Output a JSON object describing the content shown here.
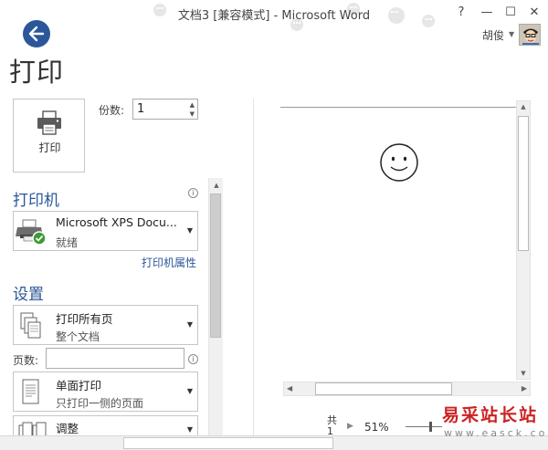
{
  "window": {
    "title": "文档3 [兼容模式] - Microsoft Word",
    "help_label": "?",
    "minimize_label": "—",
    "maximize_label": "☐",
    "close_label": "✕"
  },
  "user": {
    "name": "胡俊"
  },
  "page": {
    "title": "打印"
  },
  "print": {
    "button_label": "打印",
    "copies_label": "份数:",
    "copies_value": "1"
  },
  "printer": {
    "heading": "打印机",
    "name": "Microsoft XPS Docu...",
    "status": "就绪",
    "properties_link": "打印机属性"
  },
  "settings": {
    "heading": "设置",
    "range": {
      "title": "打印所有页",
      "subtitle": "整个文档"
    },
    "pages_label": "页数:",
    "pages_value": "",
    "sides": {
      "title": "单面打印",
      "subtitle": "只打印一侧的页面"
    },
    "collate": {
      "title": "调整"
    }
  },
  "status": {
    "total_label": "共",
    "total_count": "1",
    "zoom": "51%"
  },
  "watermark": {
    "site_name": "易采站长站",
    "url": "www.easck.com"
  },
  "icons": [
    "back-arrow-icon",
    "printer-icon",
    "info-icon",
    "pages-icon",
    "single-sided-icon",
    "collate-icon",
    "smiley-icon"
  ],
  "colors": {
    "accent": "#2b579a",
    "watermark": "#cc2222"
  }
}
